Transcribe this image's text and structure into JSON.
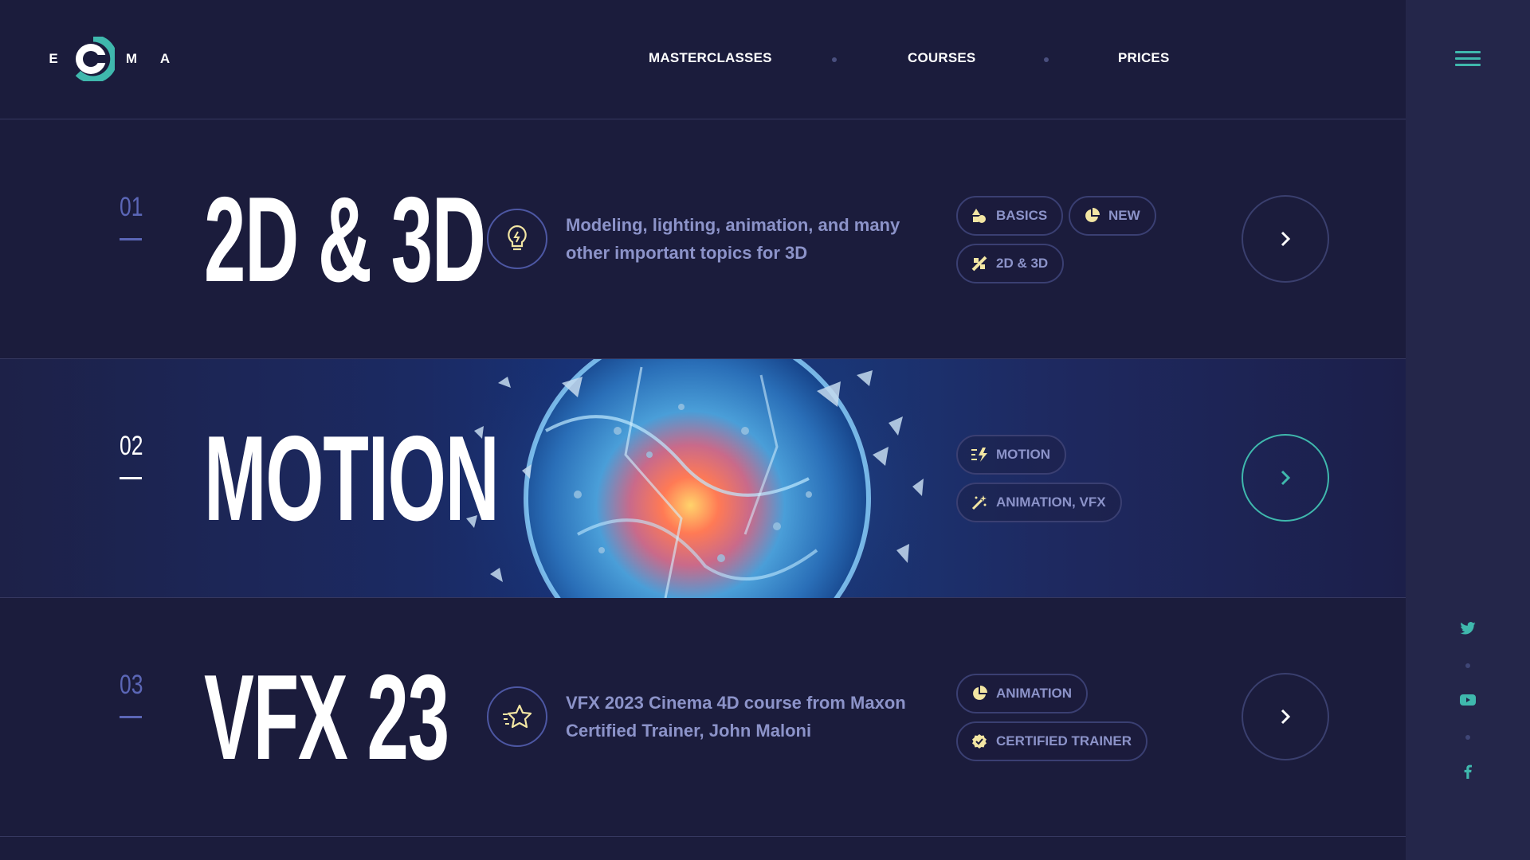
{
  "logo": {
    "letters": [
      "E",
      "M",
      "A"
    ]
  },
  "nav": {
    "items": [
      "MASTERCLASSES",
      "COURSES",
      "PRICES"
    ]
  },
  "courses": [
    {
      "number": "01",
      "title": "2D & 3D",
      "icon": "lightbulb-icon",
      "description": "Modeling, lighting, animation, and many other important topics for 3D",
      "tags": [
        {
          "label": "BASICS",
          "icon": "shapes-icon"
        },
        {
          "label": "NEW",
          "icon": "pie-icon"
        },
        {
          "label": "2D & 3D",
          "icon": "tools-icon"
        }
      ]
    },
    {
      "number": "02",
      "title": "MOTION",
      "image": "shattered glass sphere with glowing core",
      "tags": [
        {
          "label": "MOTION",
          "icon": "lightning-lines-icon"
        },
        {
          "label": "ANIMATION, VFX",
          "icon": "magic-wand-icon"
        }
      ]
    },
    {
      "number": "03",
      "title": "VFX 23",
      "icon": "star-icon",
      "description": "VFX 2023 Cinema 4D course from Maxon Certified Trainer, John Maloni",
      "tags": [
        {
          "label": "ANIMATION",
          "icon": "pie-icon"
        },
        {
          "label": "CERTIFIED TRAINER",
          "icon": "badge-check-icon"
        }
      ]
    }
  ],
  "social": [
    "twitter-icon",
    "youtube-icon",
    "facebook-icon"
  ],
  "colors": {
    "accent": "#3fb8ad",
    "background": "#1b1c3c",
    "sidebar": "#24264a",
    "muted_text": "#8c93c9",
    "icon_yellow": "#f3e6a3"
  }
}
